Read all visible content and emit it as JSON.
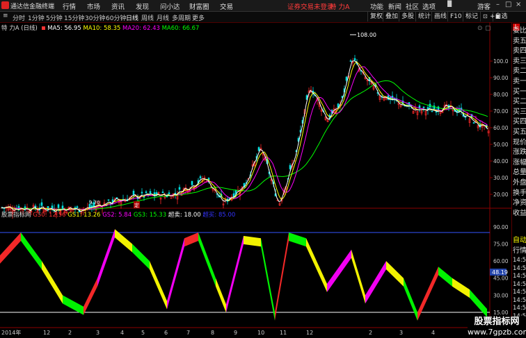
{
  "app": {
    "title": "通达信金融终端"
  },
  "menu": {
    "items": [
      "行情",
      "市场",
      "资讯",
      "发现",
      "问小达",
      "财富圈",
      "交易"
    ],
    "alert": "证券交易未登录",
    "stock_short": "特 力A",
    "right_items": [
      "功能",
      "新闻",
      "社区",
      "选项"
    ],
    "guest": "游客"
  },
  "toolbar": {
    "timeframes": [
      "分时",
      "1分钟",
      "5分钟",
      "15分钟",
      "30分钟",
      "60分钟",
      "日线",
      "周线",
      "月线",
      "多周期",
      "更多"
    ],
    "active_index": 6,
    "right_tools": [
      "复权",
      "叠加",
      "多股",
      "统计",
      "画线",
      "F10",
      "标记"
    ]
  },
  "legend": {
    "stock": "特 力A (日线)",
    "ma5": "MA5: 56.95",
    "ma10": "MA10: 58.35",
    "ma20": "MA20: 62.43",
    "ma60": "MA60: 66.67"
  },
  "price_axis": [
    "100.0",
    "90.00",
    "80.00",
    "70.00",
    "60.00",
    "50.00",
    "40.00",
    "30.00",
    "20.00"
  ],
  "peak_label": "108.00",
  "low_label": "9.70",
  "marker_label": "定",
  "indicator": {
    "name": "股票指标网",
    "gs0": "GS0: 12.56",
    "gs1": "GS1: 13.26",
    "gs2": "GS2: 5.84",
    "gs3": "GS3: 15.33",
    "overbuy": "超卖: 18.00",
    "oversell": "超买: 85.00",
    "axis": [
      "90.00",
      "75.00",
      "60.00",
      "45.00",
      "30.00",
      "15.00"
    ],
    "current_tag": "48.19"
  },
  "right_panel": {
    "items": [
      "委比",
      "卖五",
      "卖四",
      "卖三",
      "卖二",
      "卖一",
      "买一",
      "买二",
      "买三",
      "买四",
      "买五",
      "现价",
      "涨跌",
      "涨幅",
      "总量",
      "外盘",
      "换手",
      "净资",
      "收益"
    ],
    "tabs": [
      "自动",
      "行情"
    ],
    "times": [
      "14:5",
      "14:5",
      "14:5",
      "14:5",
      "14:5",
      "14:5",
      "14:5",
      "14:5",
      "14:5",
      "14:5"
    ],
    "add_fav": "+自选",
    "badge": "L"
  },
  "date_axis": [
    "2014年",
    "12",
    "2",
    "3",
    "4",
    "5",
    "6",
    "7",
    "8",
    "9",
    "10",
    "11",
    "12",
    "2",
    "3",
    "4"
  ],
  "watermark": {
    "line1": "股票指标网",
    "line2": "www.7gpzb.com"
  },
  "colors": {
    "up": "#ff2a2a",
    "ma5": "#ffffff",
    "ma10": "#ffff00",
    "ma20": "#ff00ff",
    "ma60": "#00ff00",
    "axis": "#8b0000"
  }
}
